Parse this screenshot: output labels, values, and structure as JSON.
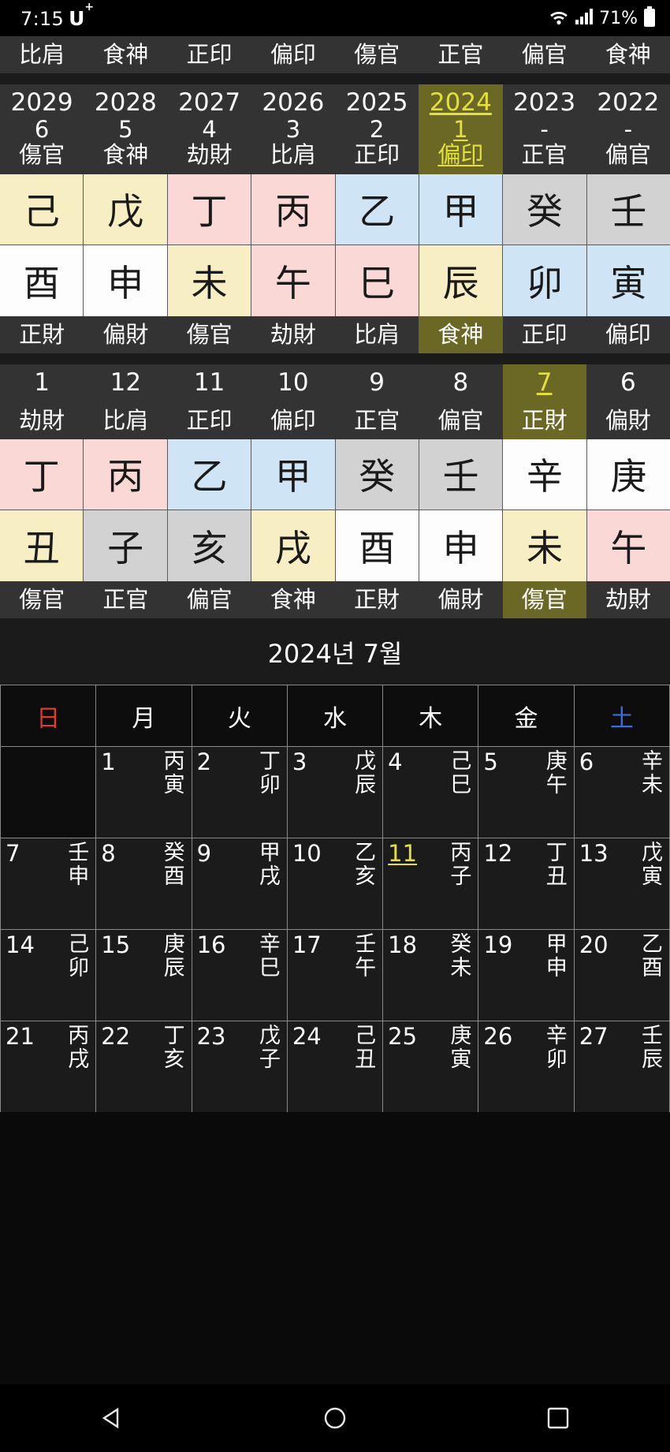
{
  "status_bar": {
    "time": "7:15",
    "carrier": "U",
    "carrier_sup": "+",
    "battery_percent": "71%",
    "icons": [
      "wifi-icon",
      "signal-icon",
      "battery-icon"
    ]
  },
  "year_section": {
    "top_labels": [
      "比肩",
      "食神",
      "正印",
      "偏印",
      "傷官",
      "正官",
      "偏官",
      "食神"
    ],
    "years": [
      "2029",
      "2028",
      "2027",
      "2026",
      "2025",
      "2024",
      "2023",
      "2022"
    ],
    "ages": [
      "6",
      "5",
      "4",
      "3",
      "2",
      "1",
      "-",
      "-"
    ],
    "sub_labels": [
      "傷官",
      "食神",
      "劫財",
      "比肩",
      "正印",
      "偏印",
      "正官",
      "偏官"
    ],
    "stems": [
      "己",
      "戊",
      "丁",
      "丙",
      "乙",
      "甲",
      "癸",
      "壬"
    ],
    "stem_colors": [
      "c-yellow",
      "c-yellow",
      "c-pink",
      "c-pink",
      "c-blue",
      "c-blue",
      "c-gray",
      "c-gray"
    ],
    "branches": [
      "酉",
      "申",
      "未",
      "午",
      "巳",
      "辰",
      "卯",
      "寅"
    ],
    "branch_colors": [
      "c-white",
      "c-white",
      "c-yellow",
      "c-pink",
      "c-pink",
      "c-yellow",
      "c-blue",
      "c-blue"
    ],
    "bottom_labels": [
      "正財",
      "偏財",
      "傷官",
      "劫財",
      "比肩",
      "食神",
      "正印",
      "偏印"
    ],
    "highlight_index": 5
  },
  "month_section": {
    "months": [
      "1",
      "12",
      "11",
      "10",
      "9",
      "8",
      "7",
      "6"
    ],
    "top_labels": [
      "劫財",
      "比肩",
      "正印",
      "偏印",
      "正官",
      "偏官",
      "正財",
      "偏財"
    ],
    "stems": [
      "丁",
      "丙",
      "乙",
      "甲",
      "癸",
      "壬",
      "辛",
      "庚"
    ],
    "stem_colors": [
      "c-pink",
      "c-pink",
      "c-blue",
      "c-blue",
      "c-gray",
      "c-gray",
      "c-white",
      "c-white"
    ],
    "branches": [
      "丑",
      "子",
      "亥",
      "戌",
      "酉",
      "申",
      "未",
      "午"
    ],
    "branch_colors": [
      "c-yellow",
      "c-gray",
      "c-gray",
      "c-yellow",
      "c-white",
      "c-white",
      "c-yellow",
      "c-pink"
    ],
    "bottom_labels": [
      "傷官",
      "正官",
      "偏官",
      "食神",
      "正財",
      "偏財",
      "傷官",
      "劫財"
    ],
    "highlight_index": 6
  },
  "calendar": {
    "title": "2024년 7월",
    "weekday_headers": [
      "日",
      "月",
      "火",
      "水",
      "木",
      "金",
      "土"
    ],
    "today": "11",
    "weeks": [
      [
        {
          "day": "",
          "gz": ""
        },
        {
          "day": "1",
          "gz": "丙寅"
        },
        {
          "day": "2",
          "gz": "丁卯"
        },
        {
          "day": "3",
          "gz": "戊辰"
        },
        {
          "day": "4",
          "gz": "己巳"
        },
        {
          "day": "5",
          "gz": "庚午"
        },
        {
          "day": "6",
          "gz": "辛未"
        }
      ],
      [
        {
          "day": "7",
          "gz": "壬申"
        },
        {
          "day": "8",
          "gz": "癸酉"
        },
        {
          "day": "9",
          "gz": "甲戌"
        },
        {
          "day": "10",
          "gz": "乙亥"
        },
        {
          "day": "11",
          "gz": "丙子"
        },
        {
          "day": "12",
          "gz": "丁丑"
        },
        {
          "day": "13",
          "gz": "戊寅"
        }
      ],
      [
        {
          "day": "14",
          "gz": "己卯"
        },
        {
          "day": "15",
          "gz": "庚辰"
        },
        {
          "day": "16",
          "gz": "辛巳"
        },
        {
          "day": "17",
          "gz": "壬午"
        },
        {
          "day": "18",
          "gz": "癸未"
        },
        {
          "day": "19",
          "gz": "甲申"
        },
        {
          "day": "20",
          "gz": "乙酉"
        }
      ],
      [
        {
          "day": "21",
          "gz": "丙戌"
        },
        {
          "day": "22",
          "gz": "丁亥"
        },
        {
          "day": "23",
          "gz": "戊子"
        },
        {
          "day": "24",
          "gz": "己丑"
        },
        {
          "day": "25",
          "gz": "庚寅"
        },
        {
          "day": "26",
          "gz": "辛卯"
        },
        {
          "day": "27",
          "gz": "壬辰"
        }
      ]
    ]
  },
  "nav_bar": {
    "items": [
      "back-icon",
      "home-icon",
      "recents-icon"
    ]
  },
  "colors": {
    "highlight": "#6b6826",
    "highlight_text": "#e3e03a",
    "sunday": "#e03a2a",
    "saturday": "#3a6be0"
  }
}
